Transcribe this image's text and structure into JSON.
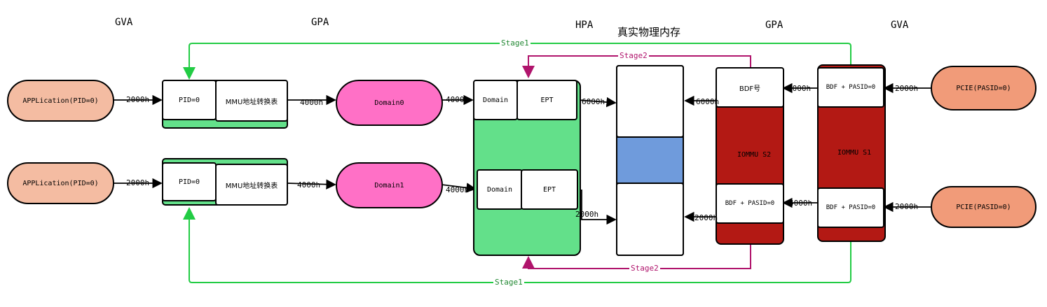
{
  "headers": {
    "gva_left": "GVA",
    "gpa_left": "GPA",
    "hpa": "HPA",
    "real_memory": "真实物理内存",
    "gpa_right": "GPA",
    "gva_right": "GVA"
  },
  "colors": {
    "app": "#f4bca2",
    "domain": "#ff70c6",
    "green": "#63e08a",
    "memory_band": "#6f9bdc",
    "iommu": "#b31914",
    "pcie": "#f19b79",
    "stage1_line": "#22cc44",
    "stage2_line": "#b0146c"
  },
  "left": {
    "app1": "APPLication(PID=0)",
    "app2": "APPLication(PID=0)",
    "addr_app1": "2000h",
    "addr_app2": "2000h",
    "pid1": "PID=0",
    "pid2": "PID=0",
    "mmu1": "MMU地址转换表",
    "mmu2": "MMU地址转换表",
    "addr_mmu1": "4000h",
    "addr_mmu2": "4000h",
    "domain0": "Domain0",
    "domain1": "Domain1",
    "addr_dom0": "4000h",
    "addr_dom1": "4000h"
  },
  "ept": {
    "domain_top": "Domain",
    "ept_top": "EPT",
    "domain_bottom": "Domain",
    "ept_bottom": "EPT",
    "addr_top": "6000h",
    "addr_bottom": "2000h"
  },
  "right": {
    "bdf_num": "BDF号",
    "iommu_s2": "IOMMU S2",
    "bdf_pasid_s2": "BDF + PASID=0",
    "addr_s2_top": "6000h",
    "addr_s2_bottom": "2000h",
    "bdf_pasid_s1_top": "BDF + PASID=0",
    "iommu_s1": "IOMMU S1",
    "bdf_pasid_s1_bottom": "BDF + PASID=0",
    "addr_s1_top": "4000h",
    "addr_s1_bottom": "4000h",
    "pcie_top": "PCIE(PASID=0)",
    "pcie_bottom": "PCIE(PASID=0)",
    "addr_pcie_top": "2000h",
    "addr_pcie_bottom": "2000h"
  },
  "stages": {
    "stage1_top": "Stage1",
    "stage2_top": "Stage2",
    "stage2_bottom": "Stage2",
    "stage1_bottom": "Stage1"
  }
}
